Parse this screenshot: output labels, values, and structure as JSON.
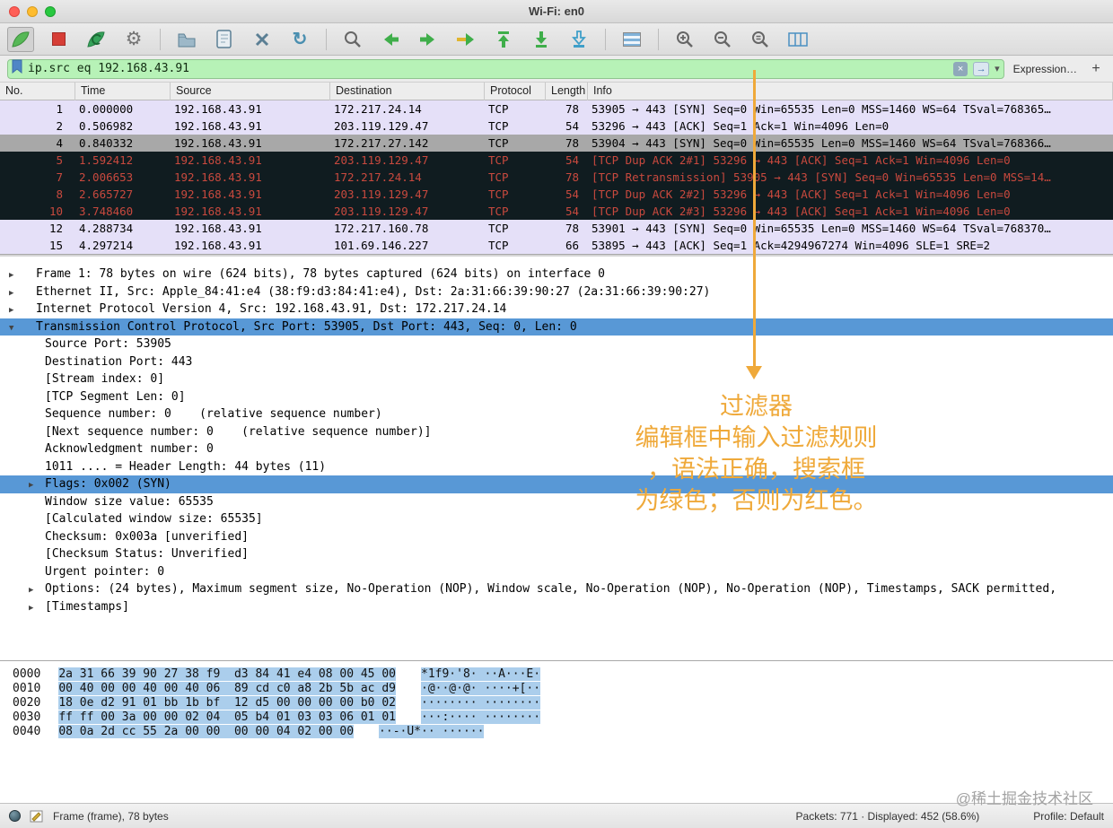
{
  "window": {
    "title": "Wi-Fi: en0"
  },
  "toolbar": {
    "pressed": "start-capture-fin-icon",
    "groups": [
      [
        "start-capture-fin-icon",
        "stop-capture-icon",
        "restart-capture-icon",
        "capture-options-gear-icon"
      ],
      [
        "open-file-icon",
        "save-file-icon",
        "close-file-icon",
        "reload-file-icon"
      ],
      [
        "find-packet-icon",
        "go-back-icon",
        "go-forward-icon",
        "go-to-packet-icon",
        "go-to-top-icon",
        "go-to-bottom-icon",
        "auto-scroll-icon"
      ],
      [
        "colorize-icon"
      ],
      [
        "zoom-in-icon",
        "zoom-out-icon",
        "zoom-original-icon",
        "resize-columns-icon"
      ]
    ]
  },
  "filter": {
    "value": "ip.src eq 192.168.43.91",
    "expression_label": "Expression…",
    "add_label": "+"
  },
  "packet_list": {
    "columns": [
      "No.",
      "Time",
      "Source",
      "Destination",
      "Protocol",
      "Length",
      "Info"
    ],
    "rows": [
      {
        "no": "1",
        "time": "0.000000",
        "source": "192.168.43.91",
        "destination": "172.217.24.14",
        "protocol": "TCP",
        "length": "78",
        "info": "53905 → 443 [SYN] Seq=0 Win=65535 Len=0 MSS=1460 WS=64 TSval=768365…",
        "style": "syn"
      },
      {
        "no": "2",
        "time": "0.506982",
        "source": "192.168.43.91",
        "destination": "203.119.129.47",
        "protocol": "TCP",
        "length": "54",
        "info": "53296 → 443 [ACK] Seq=1 Ack=1 Win=4096 Len=0",
        "style": "syn"
      },
      {
        "no": "4",
        "time": "0.840332",
        "source": "192.168.43.91",
        "destination": "172.217.27.142",
        "protocol": "TCP",
        "length": "78",
        "info": "53904 → 443 [SYN] Seq=0 Win=65535 Len=0 MSS=1460 WS=64 TSval=768366…",
        "style": "selected"
      },
      {
        "no": "5",
        "time": "1.592412",
        "source": "192.168.43.91",
        "destination": "203.119.129.47",
        "protocol": "TCP",
        "length": "54",
        "info": "[TCP Dup ACK 2#1] 53296 → 443 [ACK] Seq=1 Ack=1 Win=4096 Len=0",
        "style": "bad"
      },
      {
        "no": "7",
        "time": "2.006653",
        "source": "192.168.43.91",
        "destination": "172.217.24.14",
        "protocol": "TCP",
        "length": "78",
        "info": "[TCP Retransmission] 53905 → 443 [SYN] Seq=0 Win=65535 Len=0 MSS=14…",
        "style": "bad"
      },
      {
        "no": "8",
        "time": "2.665727",
        "source": "192.168.43.91",
        "destination": "203.119.129.47",
        "protocol": "TCP",
        "length": "54",
        "info": "[TCP Dup ACK 2#2] 53296 → 443 [ACK] Seq=1 Ack=1 Win=4096 Len=0",
        "style": "bad"
      },
      {
        "no": "10",
        "time": "3.748460",
        "source": "192.168.43.91",
        "destination": "203.119.129.47",
        "protocol": "TCP",
        "length": "54",
        "info": "[TCP Dup ACK 2#3] 53296 → 443 [ACK] Seq=1 Ack=1 Win=4096 Len=0",
        "style": "bad"
      },
      {
        "no": "12",
        "time": "4.288734",
        "source": "192.168.43.91",
        "destination": "172.217.160.78",
        "protocol": "TCP",
        "length": "78",
        "info": "53901 → 443 [SYN] Seq=0 Win=65535 Len=0 MSS=1460 WS=64 TSval=768370…",
        "style": "syn"
      },
      {
        "no": "15",
        "time": "4.297214",
        "source": "192.168.43.91",
        "destination": "101.69.146.227",
        "protocol": "TCP",
        "length": "66",
        "info": "53895 → 443 [ACK] Seq=1 Ack=4294967274 Win=4096 SLE=1 SRE=2",
        "style": "syn"
      }
    ]
  },
  "details": {
    "lines": [
      {
        "i": 0,
        "a": "r",
        "t": "Frame 1: 78 bytes on wire (624 bits), 78 bytes captured (624 bits) on interface 0"
      },
      {
        "i": 0,
        "a": "r",
        "t": "Ethernet II, Src: Apple_84:41:e4 (38:f9:d3:84:41:e4), Dst: 2a:31:66:39:90:27 (2a:31:66:39:90:27)"
      },
      {
        "i": 0,
        "a": "r",
        "t": "Internet Protocol Version 4, Src: 192.168.43.91, Dst: 172.217.24.14"
      },
      {
        "i": 0,
        "a": "d",
        "t": "Transmission Control Protocol, Src Port: 53905, Dst Port: 443, Seq: 0, Len: 0",
        "h": true
      },
      {
        "i": 1,
        "a": "",
        "t": "Source Port: 53905"
      },
      {
        "i": 1,
        "a": "",
        "t": "Destination Port: 443"
      },
      {
        "i": 1,
        "a": "",
        "t": "[Stream index: 0]"
      },
      {
        "i": 1,
        "a": "",
        "t": "[TCP Segment Len: 0]"
      },
      {
        "i": 1,
        "a": "",
        "t": "Sequence number: 0    (relative sequence number)"
      },
      {
        "i": 1,
        "a": "",
        "t": "[Next sequence number: 0    (relative sequence number)]"
      },
      {
        "i": 1,
        "a": "",
        "t": "Acknowledgment number: 0"
      },
      {
        "i": 1,
        "a": "",
        "t": "1011 .... = Header Length: 44 bytes (11)"
      },
      {
        "i": 1,
        "a": "r",
        "t": "Flags: 0x002 (SYN)",
        "h": true
      },
      {
        "i": 1,
        "a": "",
        "t": "Window size value: 65535"
      },
      {
        "i": 1,
        "a": "",
        "t": "[Calculated window size: 65535]"
      },
      {
        "i": 1,
        "a": "",
        "t": "Checksum: 0x003a [unverified]"
      },
      {
        "i": 1,
        "a": "",
        "t": "[Checksum Status: Unverified]"
      },
      {
        "i": 1,
        "a": "",
        "t": "Urgent pointer: 0"
      },
      {
        "i": 1,
        "a": "r",
        "t": "Options: (24 bytes), Maximum segment size, No-Operation (NOP), Window scale, No-Operation (NOP), No-Operation (NOP), Timestamps, SACK permitted,"
      },
      {
        "i": 1,
        "a": "r",
        "t": "[Timestamps]"
      }
    ]
  },
  "hex": {
    "rows": [
      {
        "offset": "0000",
        "hex": "2a 31 66 39 90 27 38 f9  d3 84 41 e4 08 00 45 00",
        "ascii": "*1f9·'8· ··A···E·"
      },
      {
        "offset": "0010",
        "hex": "00 40 00 00 40 00 40 06  89 cd c0 a8 2b 5b ac d9",
        "ascii": "·@··@·@· ····+[··"
      },
      {
        "offset": "0020",
        "hex": "18 0e d2 91 01 bb 1b bf  12 d5 00 00 00 00 b0 02",
        "ascii": "········ ········"
      },
      {
        "offset": "0030",
        "hex": "ff ff 00 3a 00 00 02 04  05 b4 01 03 03 06 01 01",
        "ascii": "···:···· ········"
      },
      {
        "offset": "0040",
        "hex": "08 0a 2d cc 55 2a 00 00  00 00 04 02 00 00",
        "ascii": "··-·U*·· ······"
      }
    ]
  },
  "status": {
    "left": "Frame (frame), 78 bytes",
    "packets": "Packets: 771 · Displayed: 452 (58.6%)",
    "profile": "Profile: Default"
  },
  "annotation": {
    "lines": [
      "过滤器",
      "编辑框中输入过滤规则",
      "，语法正确，搜索框",
      "为绿色；否则为红色。"
    ]
  },
  "watermark": "@稀土掘金技术社区",
  "colors": {
    "filter_valid_bg": "#b7f2b7",
    "row_tcp_syn_bg": "#e5e0f8",
    "row_selected_bg": "#a8a8a8",
    "row_bad_bg": "#101c20",
    "row_bad_fg": "#c8493e",
    "detail_highlight_bg": "#5898d6",
    "hex_selection_bg": "#abceec",
    "annotation_orange": "#efa93a"
  }
}
